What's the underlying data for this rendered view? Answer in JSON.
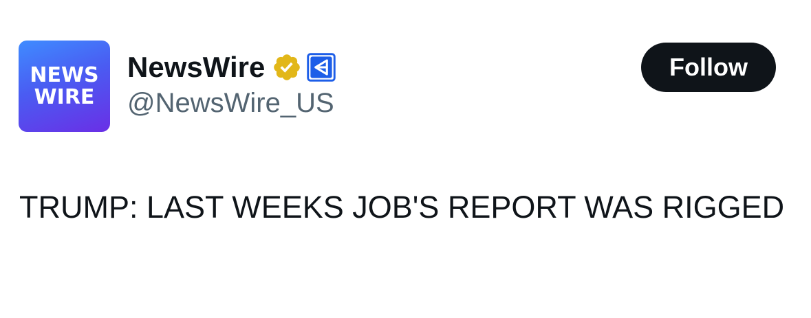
{
  "account": {
    "avatar_line1": "NEWS",
    "avatar_line2": "WIRE",
    "display_name": "NewsWire",
    "handle": "@NewsWire_US",
    "verified_badge": "gold-verified-badge-icon",
    "affiliate_badge": "affiliate-badge-icon"
  },
  "actions": {
    "follow_label": "Follow"
  },
  "post": {
    "text": "TRUMP: LAST WEEKS JOB'S REPORT WAS RIGGED"
  },
  "colors": {
    "avatar_gradient_start": "#3f8cff",
    "avatar_gradient_end": "#6a2fe6",
    "verified_gold": "#e2b719",
    "affiliate_blue": "#1d5ee8",
    "follow_bg": "#0f1419",
    "handle_gray": "#536471",
    "text": "#0f1419"
  }
}
